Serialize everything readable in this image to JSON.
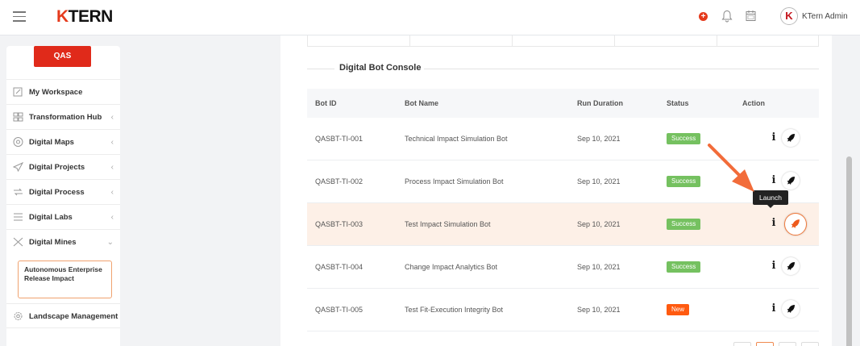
{
  "header": {
    "logo_k": "K",
    "logo_rest": "TERN",
    "admin_name": "KTern Admin",
    "avatar_letter": "K"
  },
  "sidebar": {
    "env_button": "QAS",
    "items": [
      {
        "label": "My Workspace",
        "icon": "workspace-icon"
      },
      {
        "label": "Transformation Hub",
        "icon": "grid-icon"
      },
      {
        "label": "Digital Maps",
        "icon": "map-icon"
      },
      {
        "label": "Digital Projects",
        "icon": "send-icon"
      },
      {
        "label": "Digital Process",
        "icon": "process-icon"
      },
      {
        "label": "Digital Labs",
        "icon": "labs-icon"
      },
      {
        "label": "Digital Mines",
        "icon": "mines-icon"
      }
    ],
    "sub_item": "Autonomous Enterprise Release Impact",
    "last_item": "Landscape Management",
    "chevron_left": "‹",
    "chevron_down": "⌄"
  },
  "main": {
    "section_title": "Digital Bot Console",
    "columns": [
      "Bot ID",
      "Bot Name",
      "Run Duration",
      "Status",
      "Action"
    ],
    "rows": [
      {
        "id": "QASBT-TI-001",
        "name": "Technical Impact Simulation Bot",
        "date": "Sep 10, 2021",
        "status": "Success"
      },
      {
        "id": "QASBT-TI-002",
        "name": "Process Impact Simulation Bot",
        "date": "Sep 10, 2021",
        "status": "Success"
      },
      {
        "id": "QASBT-TI-003",
        "name": "Test Impact Simulation Bot",
        "date": "Sep 10, 2021",
        "status": "Success"
      },
      {
        "id": "QASBT-TI-004",
        "name": "Change Impact Analytics Bot",
        "date": "Sep 10, 2021",
        "status": "Success"
      },
      {
        "id": "QASBT-TI-005",
        "name": "Test Fit-Execution Integrity Bot",
        "date": "Sep 10, 2021",
        "status": "New"
      }
    ],
    "tooltip": "Launch",
    "info_glyph": "i"
  },
  "colors": {
    "brand": "#e53a1c",
    "success": "#75c160",
    "new": "#ff5a10",
    "highlight_row": "#fdf0e7",
    "arrow": "#f26c3a"
  }
}
